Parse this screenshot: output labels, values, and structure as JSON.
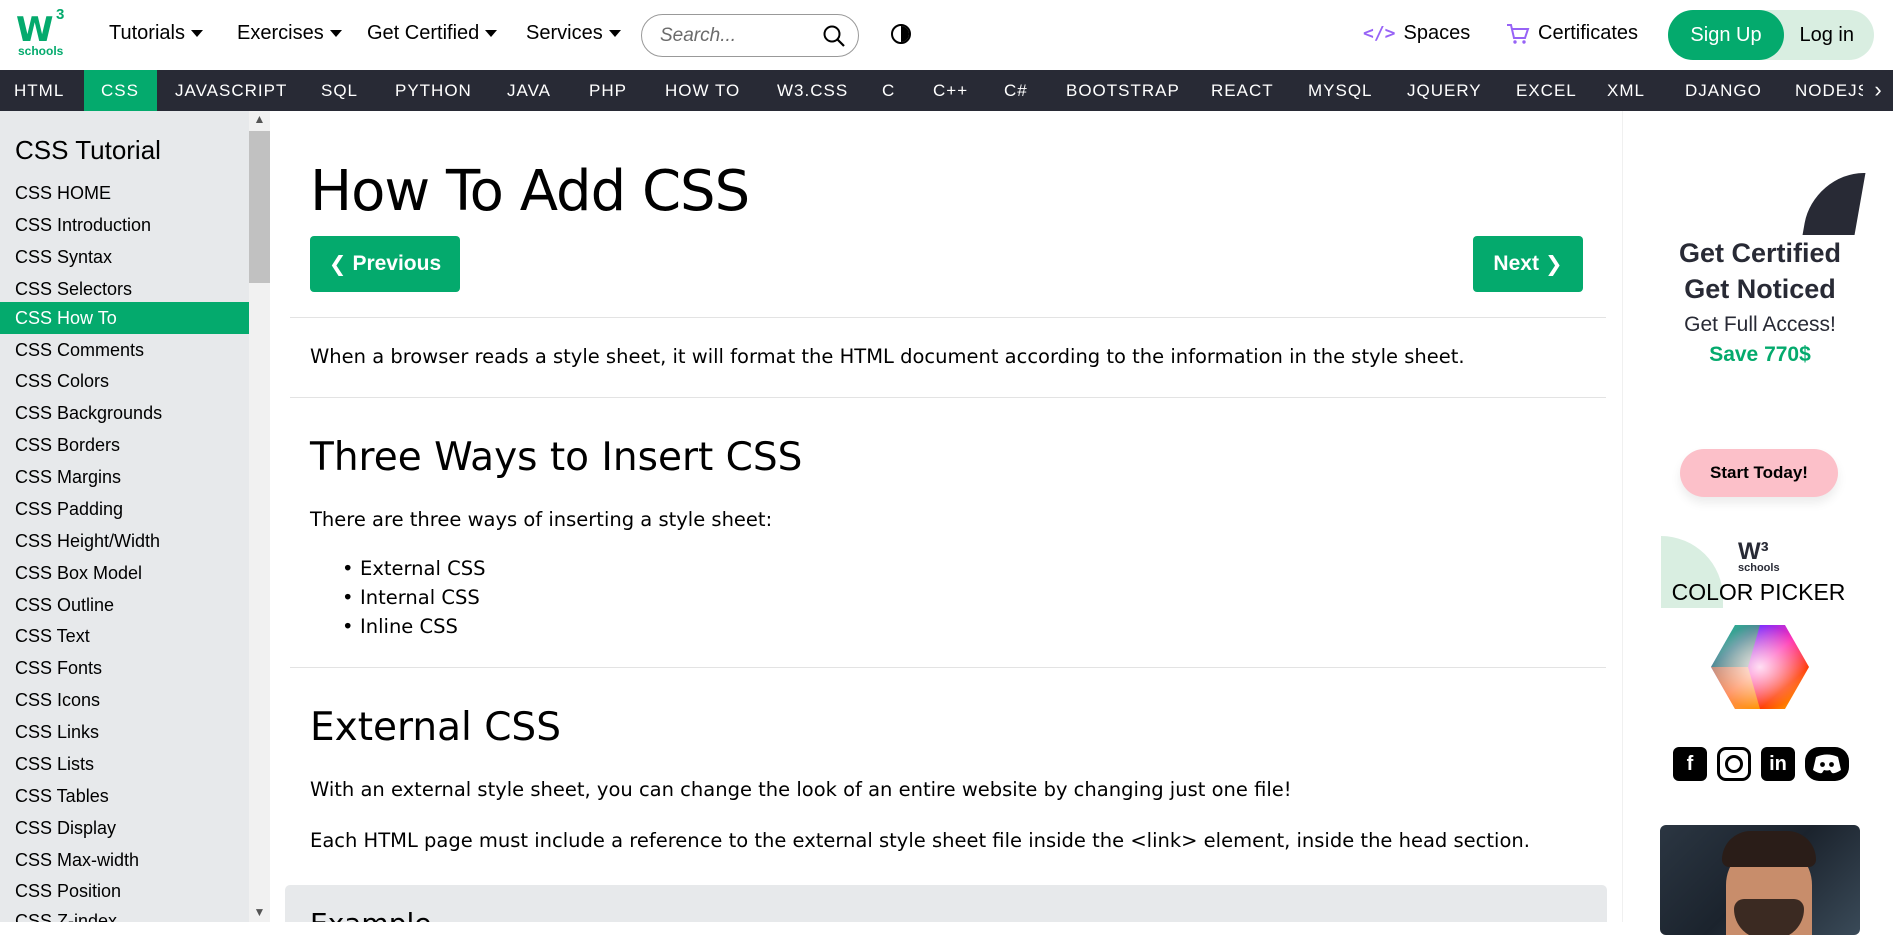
{
  "header": {
    "logo_mark": "W",
    "logo_sup": "3",
    "logo_sub": "schools",
    "nav": [
      {
        "label": "Tutorials"
      },
      {
        "label": "Exercises"
      },
      {
        "label": "Get Certified"
      },
      {
        "label": "Services"
      }
    ],
    "search_placeholder": "Search...",
    "spaces_label": "Spaces",
    "spaces_icon": "</>",
    "certificates_label": "Certificates",
    "signup_label": "Sign Up",
    "login_label": "Log in"
  },
  "subnav": {
    "items": [
      "HTML",
      "CSS",
      "JAVASCRIPT",
      "SQL",
      "PYTHON",
      "JAVA",
      "PHP",
      "HOW TO",
      "W3.CSS",
      "C",
      "C++",
      "C#",
      "BOOTSTRAP",
      "REACT",
      "MYSQL",
      "JQUERY",
      "EXCEL",
      "XML",
      "DJANGO",
      "NODEJS"
    ],
    "active": "CSS",
    "more_glyph": "›"
  },
  "sidebar": {
    "title": "CSS Tutorial",
    "items": [
      "CSS HOME",
      "CSS Introduction",
      "CSS Syntax",
      "CSS Selectors",
      "CSS How To",
      "CSS Comments",
      "CSS Colors",
      "CSS Backgrounds",
      "CSS Borders",
      "CSS Margins",
      "CSS Padding",
      "CSS Height/Width",
      "CSS Box Model",
      "CSS Outline",
      "CSS Text",
      "CSS Fonts",
      "CSS Icons",
      "CSS Links",
      "CSS Lists",
      "CSS Tables",
      "CSS Display",
      "CSS Max-width",
      "CSS Position",
      "CSS Z-index"
    ],
    "active": "CSS How To"
  },
  "main": {
    "title": "How To Add CSS",
    "prev_label": "Previous",
    "next_label": "Next",
    "intro": "When a browser reads a style sheet, it will format the HTML document according to the information in the style sheet.",
    "h_three_ways": "Three Ways to Insert CSS",
    "three_ways_text": "There are three ways of inserting a style sheet:",
    "ways": [
      "External CSS",
      "Internal CSS",
      "Inline CSS"
    ],
    "h_external": "External CSS",
    "external_p1": "With an external style sheet, you can change the look of an entire website by changing just one file!",
    "external_p2": "Each HTML page must include a reference to the external style sheet file inside the <link> element, inside the head section.",
    "example_label": "Example"
  },
  "rightcol": {
    "ad_line1": "Get Certified",
    "ad_line2": "Get Noticed",
    "ad_line3": "Get Full Access!",
    "ad_line4": "Save 770$",
    "ad_button": "Start Today!",
    "ad_logo_mark": "W³",
    "ad_logo_sub": "schools",
    "color_picker_title": "COLOR PICKER",
    "social_facebook": "f",
    "social_linkedin": "in"
  },
  "colors": {
    "brand_green": "#04AA6D",
    "nav_dark": "#282A35",
    "sidebar_bg": "#E7E9EB"
  }
}
